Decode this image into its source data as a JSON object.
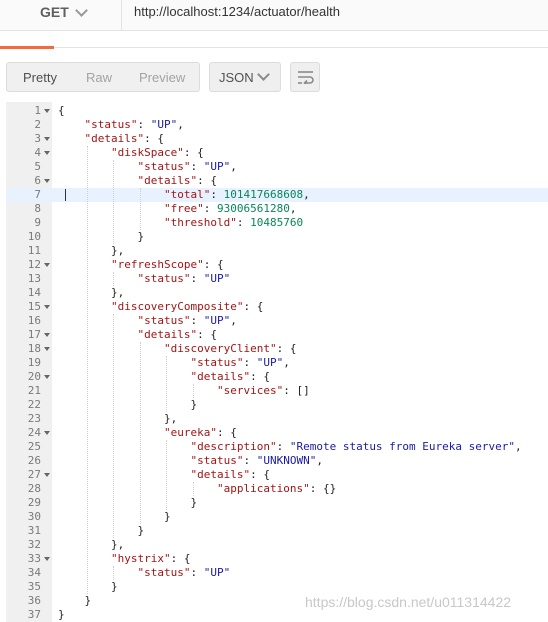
{
  "request": {
    "method": "GET",
    "url": "http://localhost:1234/actuator/health"
  },
  "response_toolbar": {
    "view_tabs": [
      "Pretty",
      "Raw",
      "Preview"
    ],
    "selected_view": "Pretty",
    "format": "JSON"
  },
  "colors": {
    "accent": "#f26b3a",
    "json_key": "#a31515",
    "json_string": "#1a1aa6",
    "json_number": "#098658",
    "active_line": "#e8f2ff"
  },
  "editor": {
    "active_line": 7,
    "lines": [
      {
        "n": "1",
        "fold": true,
        "indent": 0,
        "text": "{"
      },
      {
        "n": "2",
        "fold": false,
        "indent": 1,
        "key": "status",
        "str": "UP",
        "tail": ","
      },
      {
        "n": "3",
        "fold": true,
        "indent": 1,
        "key": "details",
        "tail": "{"
      },
      {
        "n": "4",
        "fold": true,
        "indent": 2,
        "key": "diskSpace",
        "tail": "{"
      },
      {
        "n": "5",
        "fold": false,
        "indent": 3,
        "key": "status",
        "str": "UP",
        "tail": ","
      },
      {
        "n": "6",
        "fold": true,
        "indent": 3,
        "key": "details",
        "tail": "{"
      },
      {
        "n": "7",
        "fold": false,
        "indent": 4,
        "key": "total",
        "num": "101417668608",
        "tail": ","
      },
      {
        "n": "8",
        "fold": false,
        "indent": 4,
        "key": "free",
        "num": "93006561280",
        "tail": ","
      },
      {
        "n": "9",
        "fold": false,
        "indent": 4,
        "key": "threshold",
        "num": "10485760",
        "tail": ""
      },
      {
        "n": "10",
        "fold": false,
        "indent": 3,
        "text": "}"
      },
      {
        "n": "11",
        "fold": false,
        "indent": 2,
        "text": "},"
      },
      {
        "n": "12",
        "fold": true,
        "indent": 2,
        "key": "refreshScope",
        "tail": "{"
      },
      {
        "n": "13",
        "fold": false,
        "indent": 3,
        "key": "status",
        "str": "UP",
        "tail": ""
      },
      {
        "n": "14",
        "fold": false,
        "indent": 2,
        "text": "},"
      },
      {
        "n": "15",
        "fold": true,
        "indent": 2,
        "key": "discoveryComposite",
        "tail": "{"
      },
      {
        "n": "16",
        "fold": false,
        "indent": 3,
        "key": "status",
        "str": "UP",
        "tail": ","
      },
      {
        "n": "17",
        "fold": true,
        "indent": 3,
        "key": "details",
        "tail": "{"
      },
      {
        "n": "18",
        "fold": true,
        "indent": 4,
        "key": "discoveryClient",
        "tail": "{"
      },
      {
        "n": "19",
        "fold": false,
        "indent": 5,
        "key": "status",
        "str": "UP",
        "tail": ","
      },
      {
        "n": "20",
        "fold": true,
        "indent": 5,
        "key": "details",
        "tail": "{"
      },
      {
        "n": "21",
        "fold": false,
        "indent": 6,
        "key": "services",
        "raw": "[]",
        "tail": ""
      },
      {
        "n": "22",
        "fold": false,
        "indent": 5,
        "text": "}"
      },
      {
        "n": "23",
        "fold": false,
        "indent": 4,
        "text": "},"
      },
      {
        "n": "24",
        "fold": true,
        "indent": 4,
        "key": "eureka",
        "tail": "{"
      },
      {
        "n": "25",
        "fold": false,
        "indent": 5,
        "key": "description",
        "str": "Remote status from Eureka server",
        "tail": ","
      },
      {
        "n": "26",
        "fold": false,
        "indent": 5,
        "key": "status",
        "str": "UNKNOWN",
        "tail": ","
      },
      {
        "n": "27",
        "fold": true,
        "indent": 5,
        "key": "details",
        "tail": "{"
      },
      {
        "n": "28",
        "fold": false,
        "indent": 6,
        "key": "applications",
        "raw": "{}",
        "tail": ""
      },
      {
        "n": "29",
        "fold": false,
        "indent": 5,
        "text": "}"
      },
      {
        "n": "30",
        "fold": false,
        "indent": 4,
        "text": "}"
      },
      {
        "n": "31",
        "fold": false,
        "indent": 3,
        "text": "}"
      },
      {
        "n": "32",
        "fold": false,
        "indent": 2,
        "text": "},"
      },
      {
        "n": "33",
        "fold": true,
        "indent": 2,
        "key": "hystrix",
        "tail": "{"
      },
      {
        "n": "34",
        "fold": false,
        "indent": 3,
        "key": "status",
        "str": "UP",
        "tail": ""
      },
      {
        "n": "35",
        "fold": false,
        "indent": 2,
        "text": "}"
      },
      {
        "n": "36",
        "fold": false,
        "indent": 1,
        "text": "}"
      },
      {
        "n": "37",
        "fold": false,
        "indent": 0,
        "text": "}"
      }
    ]
  },
  "watermark": "https://blog.csdn.net/u011314422"
}
